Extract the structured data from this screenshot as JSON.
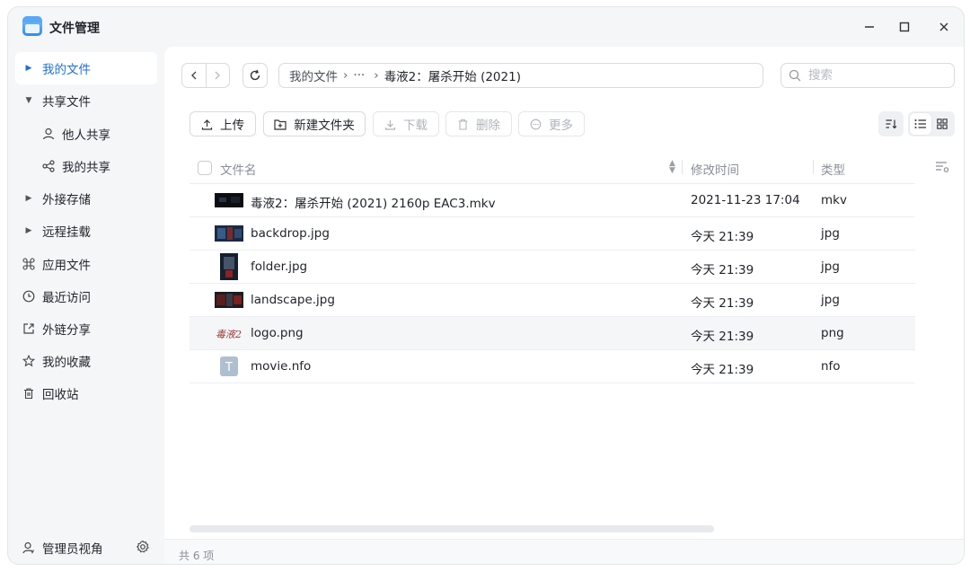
{
  "window": {
    "title": "文件管理",
    "controls": [
      "minimize",
      "maximize",
      "close"
    ]
  },
  "sidebar": {
    "items": [
      {
        "label": "我的文件",
        "lead": "caret-right-icon",
        "active": true
      },
      {
        "label": "共享文件",
        "lead": "caret-down-icon",
        "active": false
      },
      {
        "label": "他人共享",
        "lead": "person-icon",
        "active": false,
        "sub": true
      },
      {
        "label": "我的共享",
        "lead": "share-icon",
        "active": false,
        "sub": true
      },
      {
        "label": "外接存储",
        "lead": "caret-right-icon",
        "active": false
      },
      {
        "label": "远程挂载",
        "lead": "caret-right-icon",
        "active": false
      },
      {
        "label": "应用文件",
        "lead": "command-icon",
        "active": false
      },
      {
        "label": "最近访问",
        "lead": "clock-icon",
        "active": false
      },
      {
        "label": "外链分享",
        "lead": "external-share-icon",
        "active": false
      },
      {
        "label": "我的收藏",
        "lead": "star-icon",
        "active": false
      },
      {
        "label": "回收站",
        "lead": "trash-icon",
        "active": false
      }
    ],
    "footer": {
      "label": "管理员视角"
    }
  },
  "breadcrumb": {
    "root": "我的文件",
    "ellipsis": "···",
    "current": "毒液2：屠杀开始 (2021)"
  },
  "search": {
    "placeholder": "搜索",
    "value": ""
  },
  "toolbar": {
    "upload": "上传",
    "new_folder": "新建文件夹",
    "download": "下载",
    "delete": "删除",
    "more": "更多"
  },
  "table": {
    "headers": {
      "name": "文件名",
      "modified": "修改时间",
      "type": "类型"
    },
    "rows": [
      {
        "name": "毒液2：屠杀开始 (2021) 2160p EAC3.mkv",
        "modified": "2021-11-23 17:04",
        "type": "mkv",
        "thumb": "video-thumb"
      },
      {
        "name": "backdrop.jpg",
        "modified": "今天 21:39",
        "type": "jpg",
        "thumb": "backdrop-thumb"
      },
      {
        "name": "folder.jpg",
        "modified": "今天 21:39",
        "type": "jpg",
        "thumb": "poster-thumb"
      },
      {
        "name": "landscape.jpg",
        "modified": "今天 21:39",
        "type": "jpg",
        "thumb": "landscape-thumb"
      },
      {
        "name": "logo.png",
        "modified": "今天 21:39",
        "type": "png",
        "thumb": "logo-thumb",
        "logo_text": "毒液2"
      },
      {
        "name": "movie.nfo",
        "modified": "今天 21:39",
        "type": "nfo",
        "thumb": "text-file-icon",
        "icon_glyph": "T"
      }
    ]
  },
  "status": {
    "count": "共 6 项"
  },
  "colors": {
    "accent": "#1e6fd9",
    "sidebar_bg": "#f5f6f8",
    "border": "#d7dae0"
  }
}
